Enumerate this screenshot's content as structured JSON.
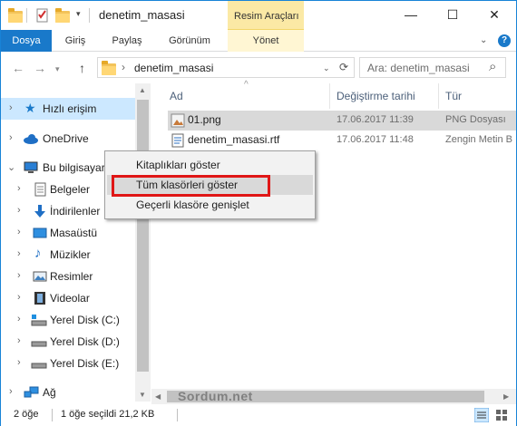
{
  "window": {
    "title": "denetim_masasi",
    "contextual_tab_group": "Resim Araçları",
    "controls": {
      "minimize": "—",
      "maximize": "☐",
      "close": "✕"
    }
  },
  "ribbon": {
    "tabs": [
      "Dosya",
      "Giriş",
      "Paylaş",
      "Görünüm",
      "Yönet"
    ],
    "chevron": "⌄",
    "help": "?"
  },
  "address": {
    "path": "denetim_masasi",
    "refresh": "⟳",
    "search_placeholder": "Ara: denetim_masasi",
    "search_icon": "⌕"
  },
  "nav": {
    "items": [
      {
        "label": "Hızlı erişim",
        "icon": "star-icon"
      },
      {
        "label": "OneDrive",
        "icon": "cloud-icon"
      },
      {
        "label": "Bu bilgisayar",
        "icon": "computer-icon"
      },
      {
        "label": "Belgeler",
        "icon": "documents-icon"
      },
      {
        "label": "İndirilenler",
        "icon": "download-icon"
      },
      {
        "label": "Masaüstü",
        "icon": "desktop-icon"
      },
      {
        "label": "Müzikler",
        "icon": "music-icon"
      },
      {
        "label": "Resimler",
        "icon": "pictures-icon"
      },
      {
        "label": "Videolar",
        "icon": "videos-icon"
      },
      {
        "label": "Yerel Disk (C:)",
        "icon": "drive-c-icon"
      },
      {
        "label": "Yerel Disk (D:)",
        "icon": "drive-icon"
      },
      {
        "label": "Yerel Disk (E:)",
        "icon": "drive-icon"
      },
      {
        "label": "Ağ",
        "icon": "network-icon"
      }
    ]
  },
  "filelist": {
    "columns": [
      "Ad",
      "Değiştirme tarihi",
      "Tür"
    ],
    "rows": [
      {
        "name": "01.png",
        "date": "17.06.2017 11:39",
        "type": "PNG Dosyası",
        "icon": "image-file-icon"
      },
      {
        "name": "denetim_masasi.rtf",
        "date": "17.06.2017 11:48",
        "type": "Zengin Metin B",
        "icon": "document-file-icon"
      }
    ]
  },
  "context_menu": {
    "items": [
      "Kitaplıkları göster",
      "Tüm klasörleri göster",
      "Geçerli klasöre genişlet"
    ],
    "highlighted_index": 1,
    "annotation_color": "#e01616"
  },
  "watermark": "Sordum.net",
  "status": {
    "item_count": "2 öğe",
    "selection": "1 öğe seçildi  21,2 KB"
  },
  "colors": {
    "accent": "#1979ca",
    "selection": "#cce8ff",
    "contextual_tab": "#fbe9a5"
  }
}
